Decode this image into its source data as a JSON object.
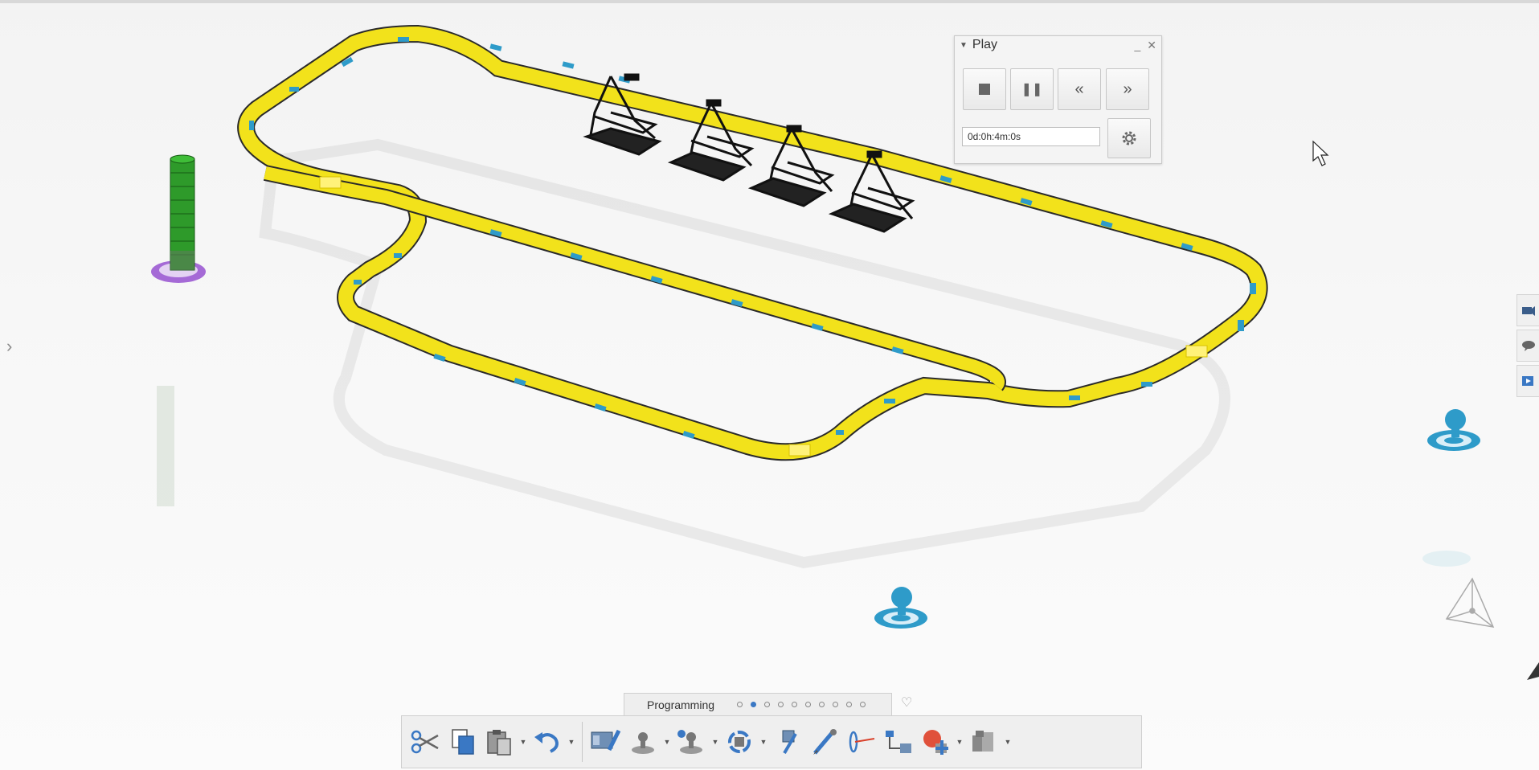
{
  "play_panel": {
    "title": "Play",
    "time_value": "0d:0h:4m:0s",
    "buttons": {
      "stop": "stop-icon",
      "pause": "pause-icon",
      "rewind": "rewind-icon",
      "fast_forward": "fast-forward-icon",
      "settings": "gear-icon"
    }
  },
  "section_bar": {
    "label": "Programming",
    "page_count": 10,
    "active_page": 2
  },
  "toolbar": {
    "icons": [
      "scissors-icon",
      "copy-icon",
      "paste-icon",
      "undo-icon",
      "robot-teach-icon",
      "device-icon",
      "device-plus-icon",
      "rotate-icon",
      "cube-tool-icon",
      "pen-tool-icon",
      "measure-icon",
      "hierarchy-icon",
      "add-object-icon",
      "library-icon"
    ]
  },
  "colors": {
    "track_yellow": "#f2e21b",
    "track_edge": "#2a2a2a",
    "marker_blue": "#2e9bc9",
    "stack_green": "#2e9a2a",
    "stack_base_purple": "#a56ad6",
    "accent_blue": "#3a78c4"
  }
}
